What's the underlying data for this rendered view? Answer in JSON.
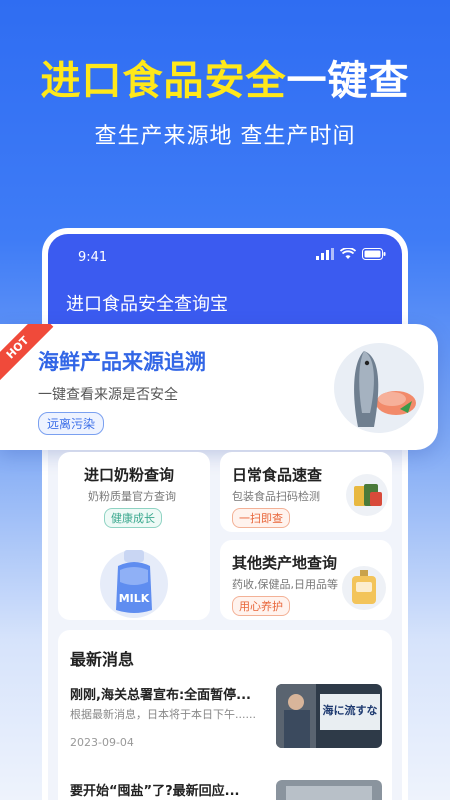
{
  "hero": {
    "title_yellow": "进口食品安全",
    "title_white": "一键查",
    "subtitle": "查生产来源地 查生产时间"
  },
  "status_bar": {
    "time": "9:41"
  },
  "app": {
    "title": "进口食品安全查询宝"
  },
  "hot_card": {
    "badge": "HOT",
    "title": "海鲜产品来源追溯",
    "desc": "一键查看来源是否安全",
    "tag": "远离污染"
  },
  "grid": {
    "milk": {
      "title": "进口奶粉查询",
      "desc": "奶粉质量官方查询",
      "tag": "健康成长",
      "icon_text": "MILK"
    },
    "daily": {
      "title": "日常食品速查",
      "desc": "包装食品扫码检测",
      "tag": "一扫即查"
    },
    "other": {
      "title": "其他类产地查询",
      "desc": "药收,保健品,日用品等",
      "tag": "用心养护"
    }
  },
  "news": {
    "heading": "最新消息",
    "items": [
      {
        "title": "刚刚,海关总署宣布:全面暂停...",
        "summary": "根据最新消息，日本将于本日下午......",
        "date": "2023-09-04",
        "thumb_text": "海に流すな"
      },
      {
        "title": "要开始“囤盐”了?最新回应..."
      }
    ]
  }
}
